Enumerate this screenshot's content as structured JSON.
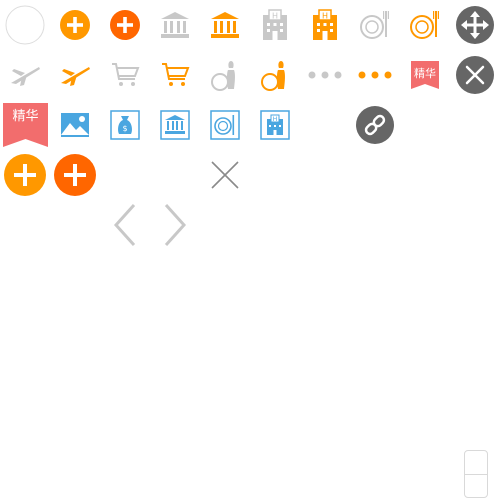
{
  "colors": {
    "orange": "#ff9800",
    "deep_orange": "#ff6600",
    "gray_icon": "#c8c8c8",
    "blue_icon": "#4aa6e0",
    "ribbon_red": "#f26d6d",
    "dark_circle": "#666666",
    "outline_circle": "#dddddd"
  },
  "badges": {
    "featured_small": "精华",
    "featured_large": "精华"
  },
  "icons": [
    "empty-circle-outline",
    "add-circle-orange",
    "add-circle-deep-orange",
    "bank-gray",
    "bank-orange",
    "hotel-gray",
    "hotel-orange",
    "dining-gray",
    "dining-orange",
    "move-arrows",
    "flight-gray",
    "flight-orange",
    "cart-gray",
    "cart-orange",
    "bowling-gray",
    "bowling-orange",
    "more-dots-gray",
    "more-dots-orange",
    "featured-ribbon",
    "close-circle-dark",
    "featured-ribbon-large",
    "image-blue",
    "money-bag-blue",
    "bank-blue",
    "dining-blue",
    "hotel-blue",
    "link-circle-dark",
    "add-circle-orange-large",
    "add-circle-deep-orange-large",
    "close-cross",
    "chevron-left",
    "chevron-right",
    "scroll-stepper"
  ]
}
